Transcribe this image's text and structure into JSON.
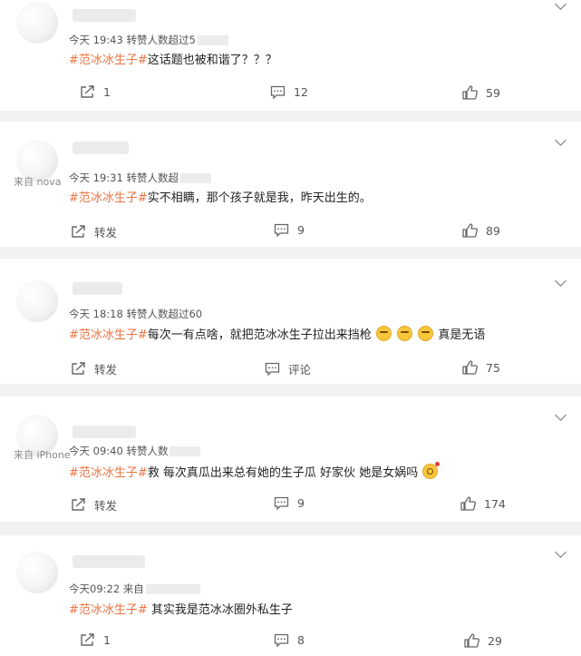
{
  "comments": [
    {
      "time": "今天 19:43",
      "forward_note": "转赞人数超过5",
      "source": "",
      "topic": "#范冰冰生子#",
      "text": "这话题也被和谐了？？？",
      "emojis": [],
      "text_after": "",
      "repost_label": "1",
      "comment_label": "12",
      "like_label": "59"
    },
    {
      "time": "今天 19:31",
      "forward_note": "转赞人数超",
      "source": "来自 nova",
      "topic": "#范冰冰生子#",
      "text": "实不相瞒，那个孩子就是我，昨天出生的。",
      "emojis": [],
      "text_after": "",
      "repost_label": "转发",
      "comment_label": "9",
      "like_label": "89"
    },
    {
      "time": "今天 18:18",
      "forward_note": "转赞人数超过60",
      "source": "",
      "topic": "#范冰冰生子#",
      "text": "每次一有点啥，就把范冰冰生子拉出来挡枪",
      "emojis": [
        "smirk-emoji",
        "smirk-emoji",
        "smirk-emoji"
      ],
      "text_after": "真是无语",
      "repost_label": "转发",
      "comment_label": "评论",
      "like_label": "75"
    },
    {
      "time": "今天 09:40",
      "forward_note": "转赞人数",
      "source": "来自 iPhone",
      "topic": "#范冰冰生子#",
      "text": "救 每次真瓜出来总有她的生子瓜 好家伙 她是女娲吗",
      "emojis": [
        "thinking-emoji"
      ],
      "text_after": "",
      "repost_label": "转发",
      "comment_label": "9",
      "like_label": "174"
    },
    {
      "time": "今天09:22",
      "forward_note": "来自",
      "source": "",
      "topic": "#范冰冰生子#",
      "text": " 其实我是范冰冰圈外私生子",
      "emojis": [],
      "text_after": "",
      "repost_label": "1",
      "comment_label": "8",
      "like_label": "29"
    }
  ]
}
